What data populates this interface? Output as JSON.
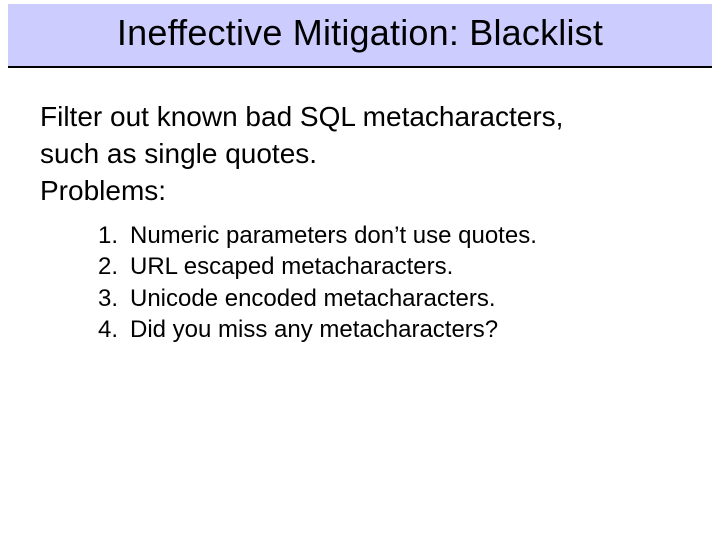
{
  "title": "Ineffective Mitigation: Blacklist",
  "intro_line1": "Filter out known bad SQL metacharacters,",
  "intro_line2": "such as single quotes.",
  "problems_label": "Problems:",
  "items": [
    {
      "num": "1.",
      "text": "Numeric parameters don’t use quotes."
    },
    {
      "num": "2.",
      "text": "URL escaped metacharacters."
    },
    {
      "num": "3.",
      "text": "Unicode encoded metacharacters."
    },
    {
      "num": "4.",
      "text": "Did you miss any metacharacters?"
    }
  ]
}
